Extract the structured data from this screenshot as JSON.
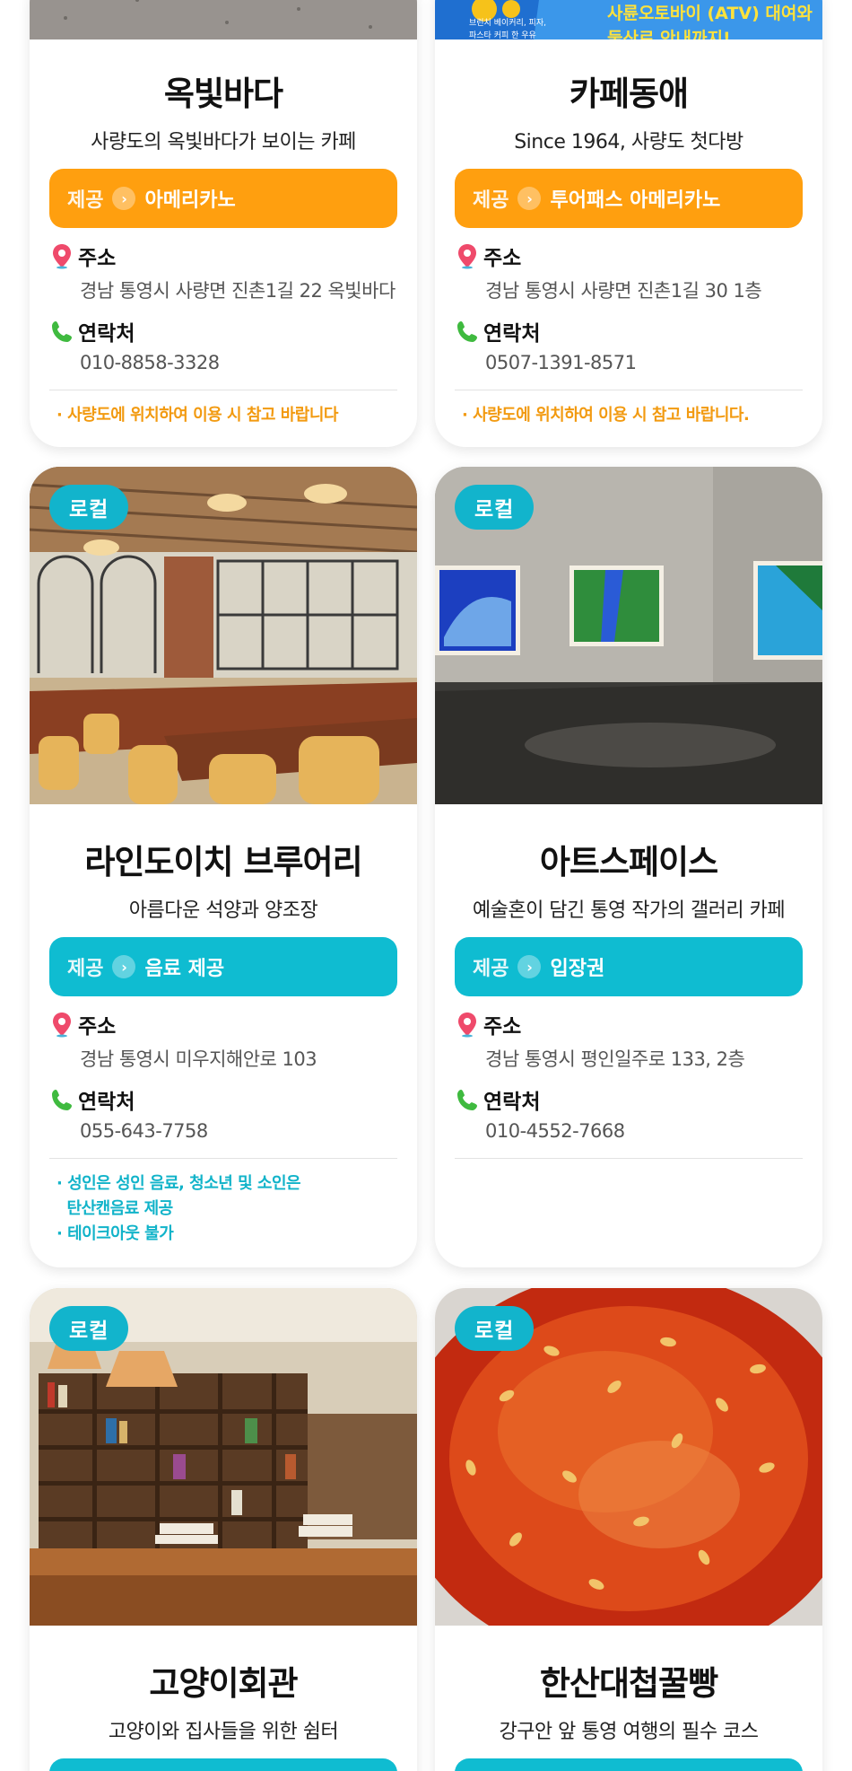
{
  "colors": {
    "orange": "#ff9f0f",
    "teal": "#0fbcd1",
    "badge": "#12b4cc",
    "note_orange": "#f29a10",
    "note_teal": "#11b3c9"
  },
  "labels": {
    "offer_prefix": "제공",
    "address": "주소",
    "contact": "연락처",
    "badge": "로컬"
  },
  "top_image_right_text": {
    "line1": "사륜오토바이 (ATV) 대여와",
    "line2": "둘산로 안내까지!",
    "small1": "브런치 베이커리, 피자,",
    "small2": "파스타 커피 한 우유"
  },
  "cards": [
    {
      "name": "옥빛바다",
      "subtitle": "사량도의 옥빛바다가 보이는 카페",
      "offer": "아메리카노",
      "address": "경남 통영시 사량면 진촌1길 22 옥빛바다",
      "phone": "010-8858-3328",
      "notes": [
        "· 사량도에 위치하여 이용 시 참고 바랍니다"
      ]
    },
    {
      "name": "카페동애",
      "subtitle": "Since 1964, 사량도 첫다방",
      "offer": "투어패스 아메리카노",
      "address": "경남 통영시 사량면 진촌1길 30 1층",
      "phone": "0507-1391-8571",
      "notes": [
        "· 사량도에 위치하여 이용 시 참고 바랍니다."
      ]
    },
    {
      "badge": "로컬",
      "image": "brewery-interior",
      "name": "라인도이치 브루어리",
      "subtitle": "아름다운 석양과 양조장",
      "offer": "음료 제공",
      "address": "경남 통영시 미우지해안로 103",
      "phone": "055-643-7758",
      "notes": [
        "· 성인은 성인 음료, 청소년 및 소인은",
        "  탄산캔음료 제공",
        "· 테이크아웃 불가"
      ]
    },
    {
      "badge": "로컬",
      "image": "gallery-interior",
      "name": "아트스페이스",
      "subtitle": "예술혼이 담긴 통영 작가의 갤러리 카페",
      "offer": "입장권",
      "address": "경남 통영시 평인일주로 133, 2층",
      "phone": "010-4552-7668",
      "notes": []
    },
    {
      "badge": "로컬",
      "image": "bookshelf-cafe",
      "name": "고양이회관",
      "subtitle": "고양이와 집사들을 위한 쉼터"
    },
    {
      "badge": "로컬",
      "image": "honey-bread",
      "name": "한산대첩꿀빵",
      "subtitle": "강구안 앞 통영 여행의 필수 코스"
    }
  ]
}
